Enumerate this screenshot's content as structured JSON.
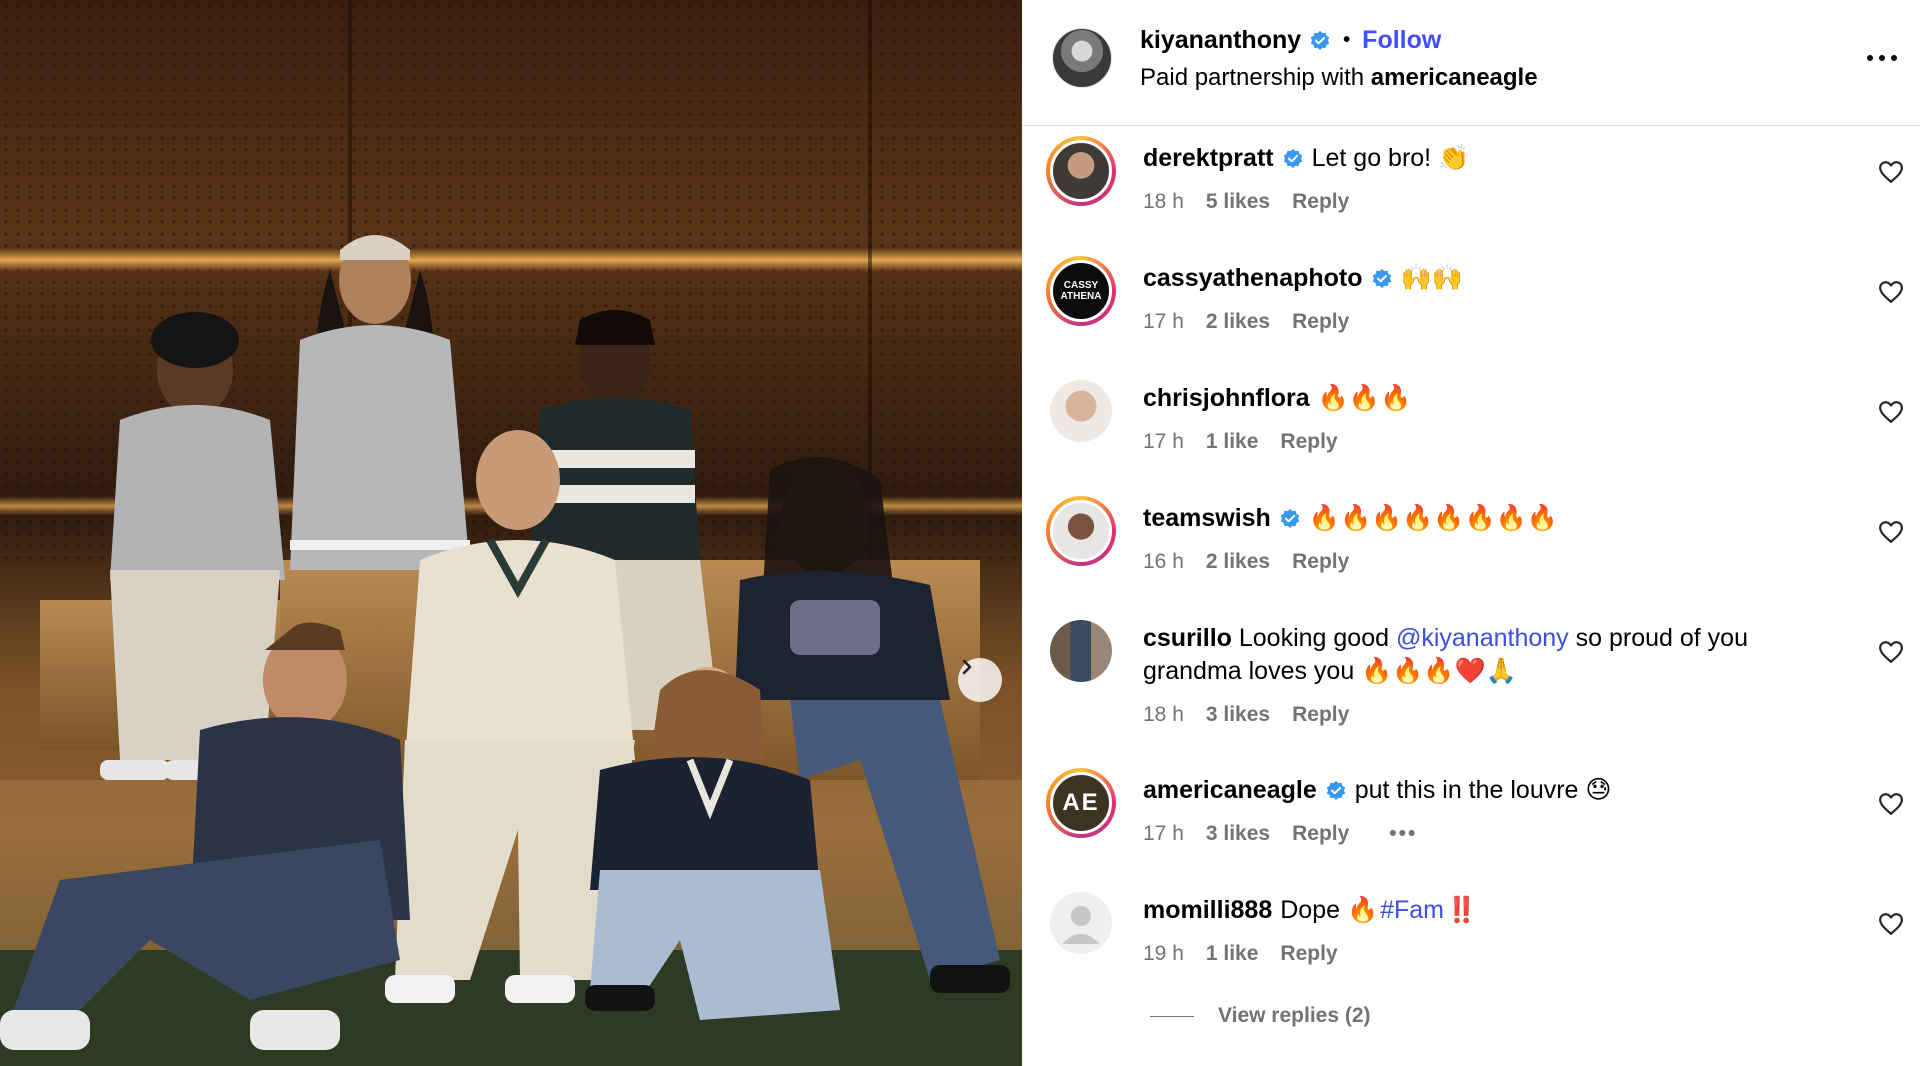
{
  "post": {
    "author": "kiyananthony",
    "follow_label": "Follow",
    "partnership_prefix": "Paid partnership with",
    "partner": "americaneagle",
    "separator": "•"
  },
  "comments": [
    {
      "user": "derektpratt",
      "verified": true,
      "text": "Let go bro! 👏",
      "time": "18 h",
      "likes": "5 likes",
      "reply": "Reply"
    },
    {
      "user": "cassyathenaphoto",
      "verified": true,
      "text": "🙌🙌",
      "time": "17 h",
      "likes": "2 likes",
      "reply": "Reply",
      "avatar_text": "CASSY ATHENA"
    },
    {
      "user": "chrisjohnflora",
      "verified": false,
      "text": "🔥🔥🔥",
      "time": "17 h",
      "likes": "1 like",
      "reply": "Reply"
    },
    {
      "user": "teamswish",
      "verified": true,
      "text": "🔥🔥🔥🔥🔥🔥🔥🔥",
      "time": "16 h",
      "likes": "2 likes",
      "reply": "Reply"
    },
    {
      "user": "csurillo",
      "verified": false,
      "text_before": "Looking good",
      "mention": "@kiyananthony",
      "text_after": "so proud of you",
      "text_line2": "grandma loves you 🔥🔥🔥❤️🙏",
      "time": "18 h",
      "likes": "3 likes",
      "reply": "Reply"
    },
    {
      "user": "americaneagle",
      "verified": true,
      "text": "put this in the louvre 😓",
      "time": "17 h",
      "likes": "3 likes",
      "reply": "Reply",
      "more": "•••",
      "avatar_text": "AE"
    },
    {
      "user": "momilli888",
      "verified": false,
      "text_before": "Dope 🔥",
      "hashtag": "#Fam",
      "text_after": "‼️",
      "time": "19 h",
      "likes": "1 like",
      "reply": "Reply"
    }
  ],
  "view_replies": "View replies (2)",
  "colors": {
    "link": "#4150f7",
    "muted": "#737373",
    "verified": "#3897f0"
  },
  "icons": {
    "header_more": "more-horizontal-icon",
    "like": "heart-outline-icon",
    "verified": "verified-badge-icon",
    "next": "chevron-right-icon"
  }
}
